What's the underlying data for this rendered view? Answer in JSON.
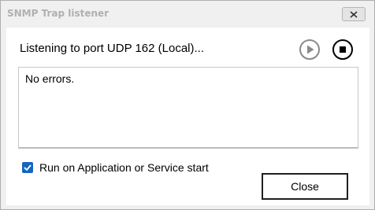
{
  "window": {
    "title": "SNMP Trap listener"
  },
  "status": {
    "text": "Listening to port UDP 162 (Local)..."
  },
  "controls": {
    "play_icon": "play-circle-icon",
    "stop_icon": "stop-circle-icon"
  },
  "log": {
    "text": "No errors."
  },
  "options": {
    "run_on_start_label": "Run on Application or Service start",
    "run_on_start_checked": true
  },
  "buttons": {
    "close_label": "Close"
  },
  "colors": {
    "checkbox_accent": "#1565c0",
    "title_text": "#b0b0b0",
    "play_icon": "#8a8a8a",
    "stop_icon": "#000000"
  }
}
